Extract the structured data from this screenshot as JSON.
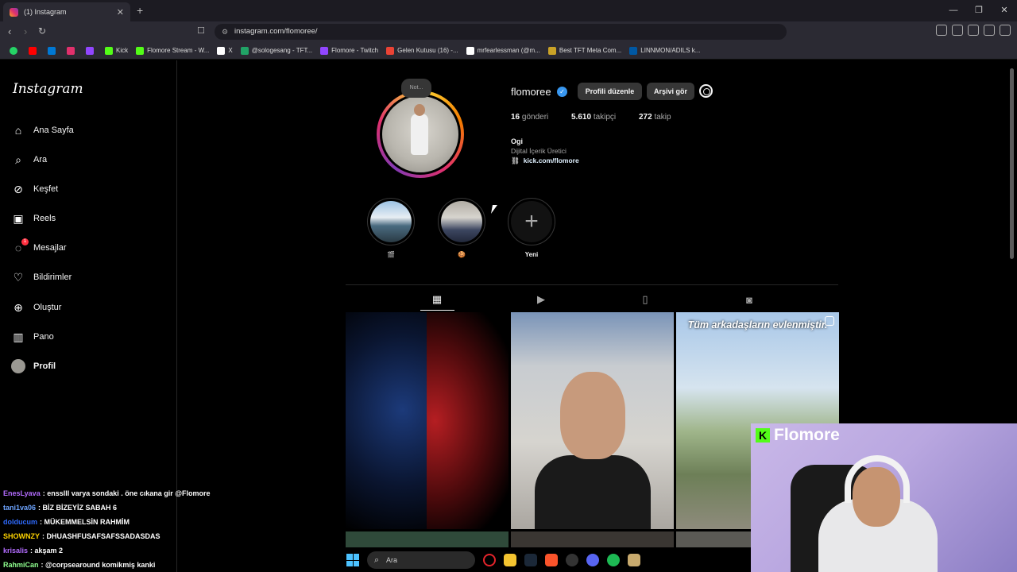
{
  "browser": {
    "tab_title": "(1) Instagram",
    "url": "instagram.com/flomoree/",
    "bookmarks": [
      {
        "label": "Kick",
        "color": "#53fc18"
      },
      {
        "label": "Flomore Stream - W...",
        "color": "#53fc18"
      },
      {
        "label": "X",
        "color": "#ffffff"
      },
      {
        "label": "@sologesang - TFT...",
        "color": "#21a366"
      },
      {
        "label": "Flomore - Twitch",
        "color": "#9146ff"
      },
      {
        "label": "Gelen Kutusu (16) -...",
        "color": "#ea4335"
      },
      {
        "label": "mrfearlessman (@m...",
        "color": "#ffffff"
      },
      {
        "label": "Best TFT Meta Com...",
        "color": "#c9a227"
      },
      {
        "label": "LINNMON/ADILS k...",
        "color": "#0058a3"
      }
    ]
  },
  "sidebar": {
    "logo": "Instagram",
    "items": [
      {
        "label": "Ana Sayfa",
        "icon": "home-icon"
      },
      {
        "label": "Ara",
        "icon": "search-icon"
      },
      {
        "label": "Keşfet",
        "icon": "compass-icon"
      },
      {
        "label": "Reels",
        "icon": "reels-icon"
      },
      {
        "label": "Mesajlar",
        "icon": "messenger-icon",
        "badge": "1"
      },
      {
        "label": "Bildirimler",
        "icon": "heart-icon"
      },
      {
        "label": "Oluştur",
        "icon": "plus-square-icon"
      },
      {
        "label": "Pano",
        "icon": "dashboard-icon"
      },
      {
        "label": "Profil",
        "icon": "avatar-icon"
      }
    ]
  },
  "profile": {
    "note": "Not...",
    "username": "flomoree",
    "edit_button": "Profili düzenle",
    "archive_button": "Arşivi gör",
    "posts_count": "16",
    "posts_label": "gönderi",
    "followers_count": "5.610",
    "followers_label": "takipçi",
    "following_count": "272",
    "following_label": "takip",
    "name": "Ogi",
    "category": "Dijital İçerik Üretici",
    "link": "kick.com/flomore"
  },
  "highlights": [
    {
      "label": "🎬"
    },
    {
      "label": "🍪"
    },
    {
      "label": "Yeni"
    }
  ],
  "posts": {
    "caption_3": "Tüm arkadaşların evlenmiştir."
  },
  "stream": {
    "brand": "Flomore",
    "chat": [
      {
        "user": "EnesLyava",
        "message": ": ensslll varya sondaki . öne cıkana gir @Flomore",
        "color": "#b36cff"
      },
      {
        "user": "tani1va06",
        "message": ": BİZ BİZEYİZ SABAH 6",
        "color": "#6da4ff"
      },
      {
        "user": "dolducum",
        "message": ": MÜKEMMELSİN RAHMİM",
        "color": "#2f6bff"
      },
      {
        "user": "SHOWNZY",
        "message": ": DHUASHFUSAFSAFSSADASDAS",
        "color": "#ffd400"
      },
      {
        "user": "krisalis",
        "message": ": akşam 2",
        "color": "#b36cff"
      },
      {
        "user": "RahmiCan",
        "message": ": @corpsearound komikmiş kanki",
        "color": "#8fff8f"
      }
    ]
  },
  "taskbar": {
    "search_placeholder": "Ara"
  }
}
